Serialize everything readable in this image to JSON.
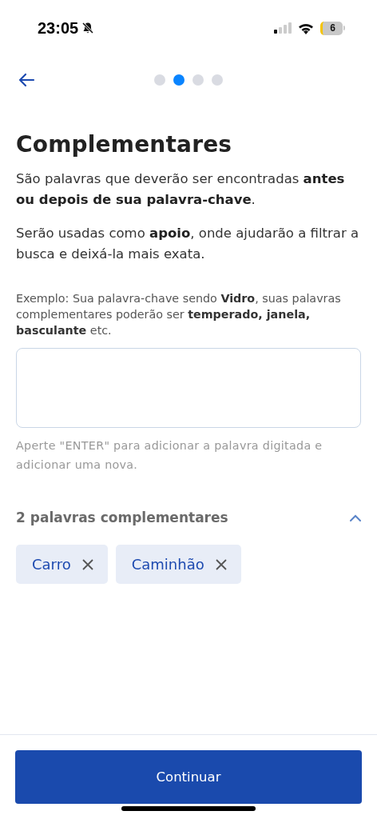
{
  "status_bar": {
    "time": "23:05",
    "battery": "6"
  },
  "stepper": [
    {
      "selected": false
    },
    {
      "selected": true
    },
    {
      "selected": false
    },
    {
      "selected": false
    }
  ],
  "title": "Complementares",
  "paragraphs": [
    "São palavras que deverão ser encontradas **antes ou depois de sua palavra-chave**.",
    "Serão usadas como **apoio**, onde ajudarão a filtrar a busca e deixá-la mais exata."
  ],
  "example": "Exemplo: Sua palavra-chave sendo **Vidro**, suas palavras complementares poderão ser **temperado, janela, basculante** etc.",
  "hint": "Aperte \"ENTER\" para adicionar a palavra digitada e adicionar uma nova.",
  "keywords": {
    "heading": "2 palavras complementares",
    "expanded": true,
    "tags": [
      {
        "label": "Carro"
      },
      {
        "label": "Caminhão"
      }
    ]
  },
  "continue_button": "Continuar"
}
